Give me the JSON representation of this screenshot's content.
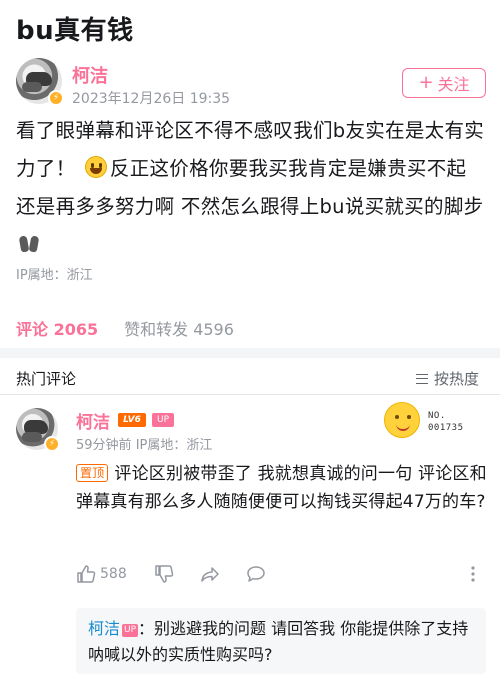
{
  "page": {
    "title": "bu真有钱"
  },
  "post": {
    "author": {
      "name": "柯洁",
      "avatar_badge_icon": "verified-badge-icon"
    },
    "timestamp": "2023年12月26日 19:35",
    "follow_button": {
      "icon": "+",
      "label": "关注"
    },
    "content": {
      "part1": "看了眼弹幕和评论区不得不感叹我们b友实在是太有实力了！",
      "emoji1": "smile-emoji",
      "part2": "反正这价格你要我买我肯定是嫌贵买不起 还是再多多努力啊 不然怎么跟得上bu说买就买的脚步",
      "emoji2": "footprints-emoji"
    },
    "ip_location": "IP属地：浙江"
  },
  "tabs": [
    {
      "label": "评论 2065",
      "active": true
    },
    {
      "label": "赞和转发 4596",
      "active": false
    }
  ],
  "comments_section": {
    "title": "热门评论",
    "sort_label": "按热度"
  },
  "comment": {
    "author": "柯洁",
    "level_badge": "LV6",
    "up_badge": "UP",
    "time": "59分钟前",
    "ip": "IP属地：浙江",
    "decoration": {
      "no_label": "NO.",
      "number": "001735"
    },
    "pin_label": "置顶",
    "text": "评论区别被带歪了 我就想真诚的问一句 评论区和弹幕真有那么多人随随便便可以掏钱买得起47万的车?",
    "likes": "588",
    "reply": {
      "author": "柯洁",
      "up_badge": "UP",
      "text": "：别逃避我的问题 请回答我 你能提供除了支持呐喊以外的实质性购买吗?"
    }
  },
  "colors": {
    "accent": "#fb7299",
    "muted": "#9499a0",
    "link": "#178bcf",
    "level": "#ff6a00"
  }
}
